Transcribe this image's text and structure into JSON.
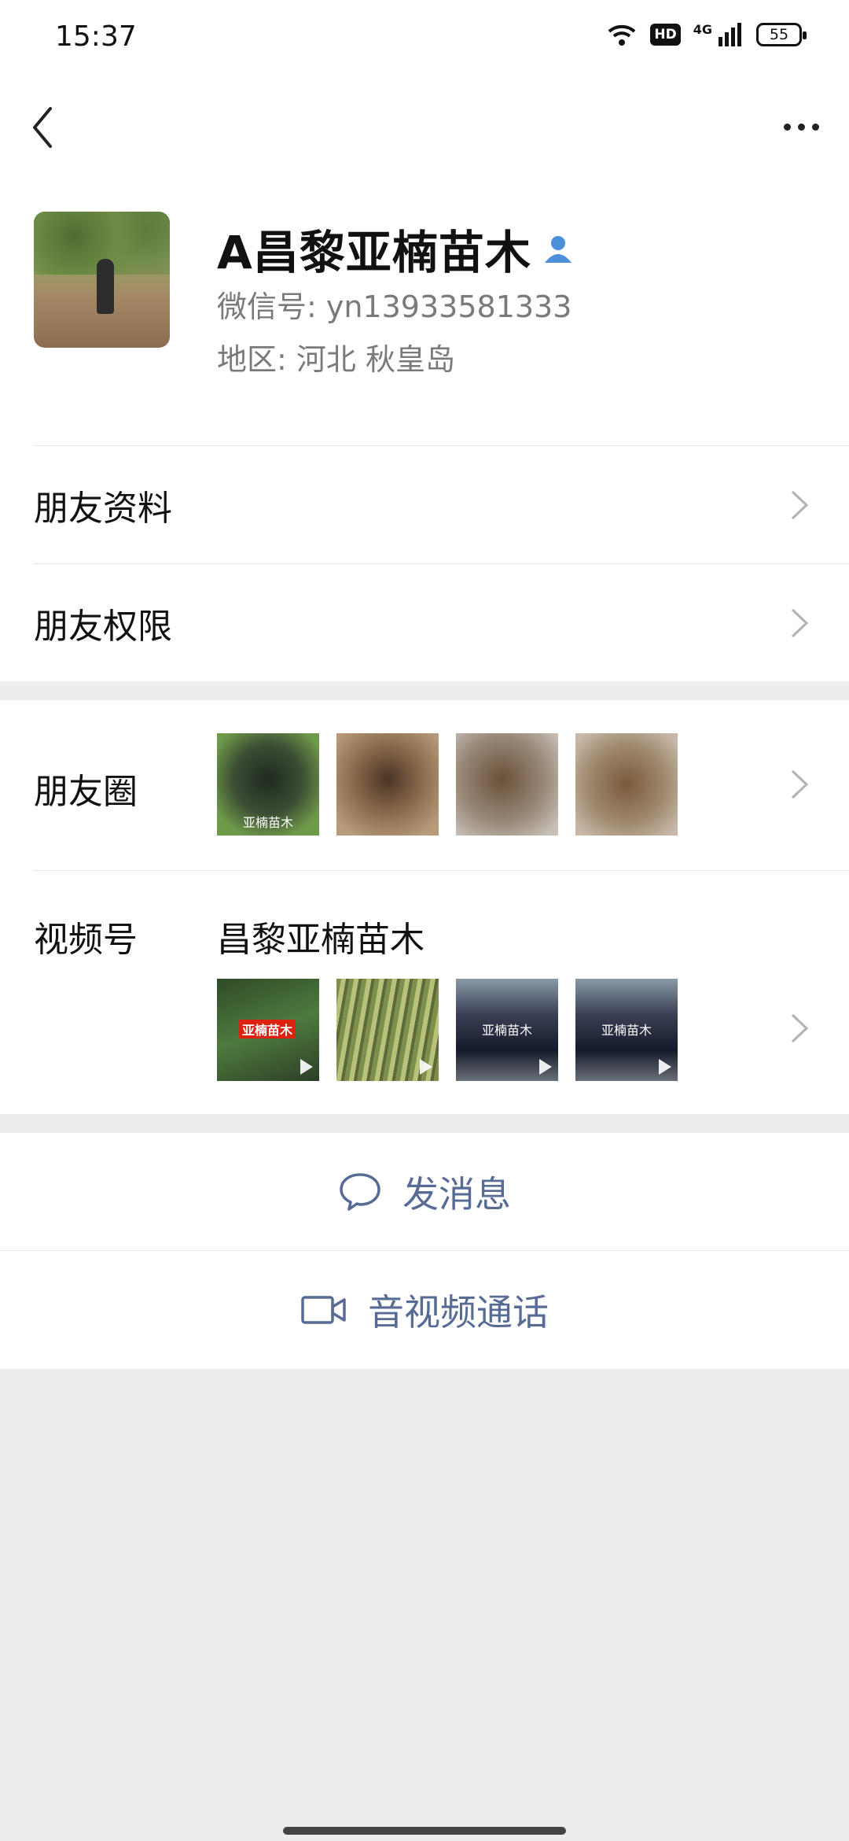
{
  "status_bar": {
    "time": "15:37",
    "battery": "55",
    "network": "4G",
    "hd_label": "HD"
  },
  "profile": {
    "name": "A昌黎亚楠苗木",
    "wechat_id": "微信号: yn13933581333",
    "region": "地区: 河北  秋皇岛"
  },
  "menu": {
    "friend_info": "朋友资料",
    "friend_permissions": "朋友权限"
  },
  "moments": {
    "label": "朋友圈",
    "thumbs": [
      {
        "caption": "亚楠苗木",
        "color": "#4d6b3a"
      },
      {
        "caption": "",
        "color": "#8a6a4c"
      },
      {
        "caption": "",
        "color": "#9a8a7a"
      },
      {
        "caption": "",
        "color": "#a08a70"
      }
    ]
  },
  "channels": {
    "label": "视频号",
    "name": "昌黎亚楠苗木",
    "thumbs": [
      {
        "caption": "亚楠苗木",
        "color": "#3f6b32"
      },
      {
        "caption": "",
        "color": "#8a9a5a"
      },
      {
        "caption": "亚楠苗木",
        "color": "#3a3f55"
      },
      {
        "caption": "亚楠苗木",
        "color": "#3a3f55"
      }
    ]
  },
  "actions": {
    "message": "发消息",
    "call": "音视频通话"
  },
  "colors": {
    "link": "#576b95",
    "background": "#ededed"
  }
}
